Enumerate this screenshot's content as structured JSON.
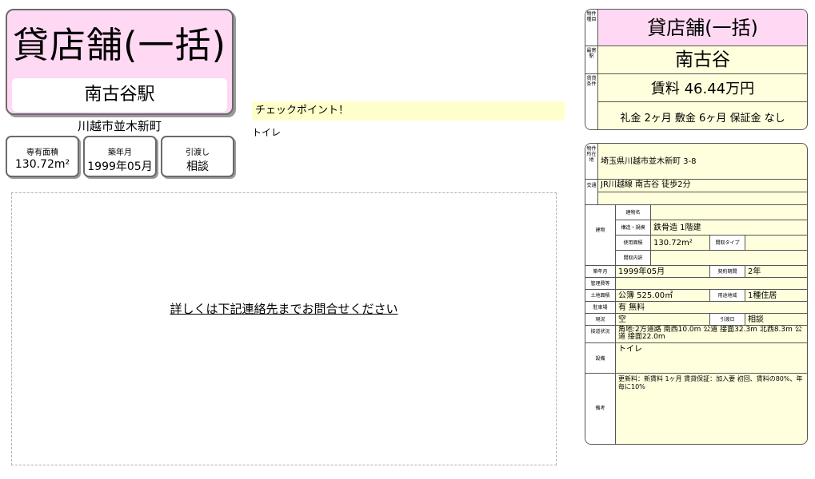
{
  "left": {
    "title": "貸店舗(一括)",
    "station": "南古谷駅",
    "address": "川越市並木新町",
    "cards": [
      {
        "label": "専有面積",
        "value": "130.72m²"
      },
      {
        "label": "築年月",
        "value": "1999年05月"
      },
      {
        "label": "引渡し",
        "value": "相談"
      }
    ]
  },
  "checkpoint": {
    "header": "チェックポイント！",
    "body": "トイレ"
  },
  "photo": {
    "message": "詳しくは下記連絡先までお問合せください"
  },
  "summary": {
    "type_label": "物件種目",
    "type": "貸店舗(一括)",
    "station_label": "最寄駅",
    "station": "南古谷",
    "terms_label": "賃貸条件",
    "rent": "賃料 46.44万円",
    "fees": "礼金 2ヶ月  敷金 6ヶ月  保証金 なし"
  },
  "details": {
    "location_label": "物件所在地",
    "location": "埼玉県川越市並木新町 3-8",
    "transport_label": "交通",
    "transport": "JR川越線 南古谷 徒歩2分",
    "building_label": "建物",
    "building_name_label": "建物名",
    "building_name": "",
    "structure_label": "構造・規模",
    "structure": "鉄骨造 1階建",
    "area_label": "使用面積",
    "area": "130.72m²",
    "layout_label": "間取タイプ",
    "layout": "",
    "layout_detail_label": "間取内訳",
    "layout_detail": "",
    "built_label": "築年月",
    "built": "1999年05月",
    "contract_label": "契約期間",
    "contract": "2年",
    "mgmt_label": "管理費等",
    "mgmt": "",
    "land_label": "土地面積",
    "land": "公簿 525.00㎡",
    "zoning_label": "用途地域",
    "zoning": "1種住居",
    "parking_label": "駐車場",
    "parking": "有 無料",
    "status_label": "現況",
    "status": "空",
    "handover_label": "引渡日",
    "handover": "相談",
    "road_label": "接道状況",
    "road": "角地:2方道路  南西10.0m 公道 接面32.3m  北西8.3m 公道 接面22.0m",
    "facility_label": "設備",
    "facility": "トイレ",
    "remarks_label": "備考",
    "remarks": "更新料：新賃料 1ヶ月  賃貸保証：加入要 初回、賃料の80%、年毎に10%"
  }
}
